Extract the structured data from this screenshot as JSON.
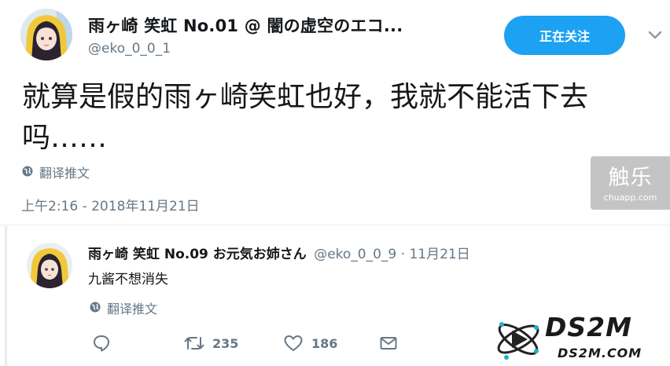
{
  "main_tweet": {
    "display_name": "雨ヶ崎 笑虹 No.01 @ 闇の虚空のエコ...",
    "handle": "@eko_0_0_1",
    "follow_label": "正在关注",
    "text": "就算是假的雨ヶ崎笑虹也好，我就不能活下去吗……",
    "translate_label": "翻译推文",
    "timestamp": "上午2:16 - 2018年11月21日"
  },
  "reply_tweet": {
    "display_name": "雨ヶ崎 笑虹 No.09 お元気お姉さん",
    "meta": "@eko_0_0_9 · 11月21日",
    "text": "九酱不想消失",
    "translate_label": "翻译推文",
    "retweet_count": "235",
    "like_count": "186"
  },
  "watermarks": {
    "chuapp_big": "触乐",
    "chuapp_small": "chuapp.com",
    "ds2m_word": "DS2M",
    "ds2m_url": "DS2M.COM"
  },
  "colors": {
    "accent": "#1da1f2",
    "muted_text": "#657786",
    "primary_text": "#14171a",
    "divider": "#e6ecf0"
  },
  "icons": [
    "chevron-down-icon",
    "globe-icon",
    "reply-icon",
    "retweet-icon",
    "like-icon",
    "message-icon"
  ]
}
